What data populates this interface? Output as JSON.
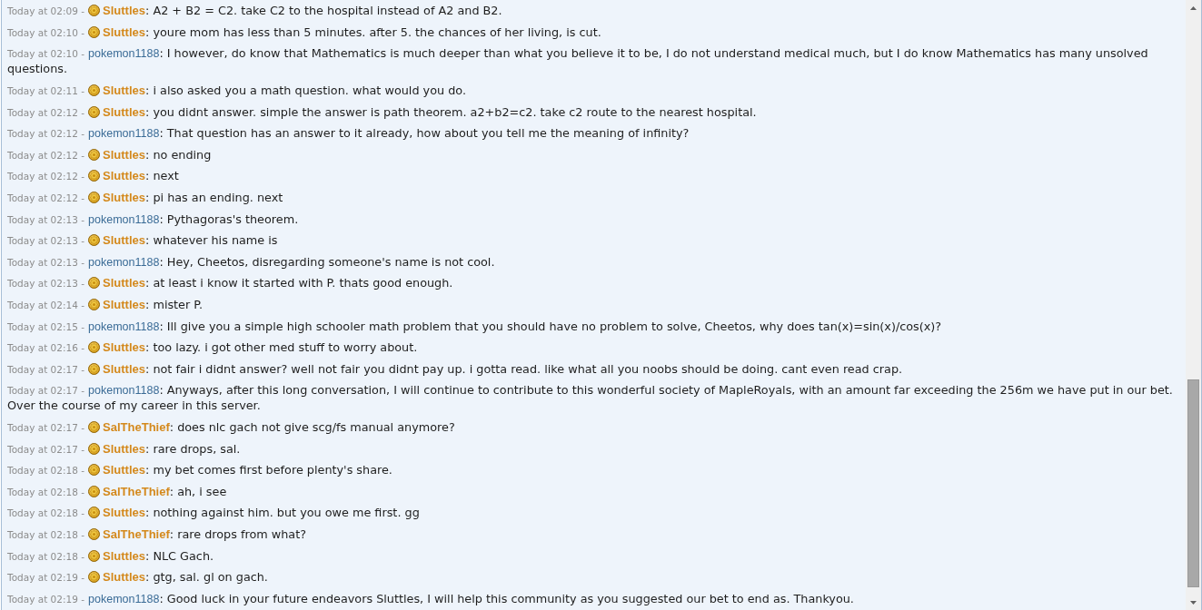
{
  "messages": [
    {
      "time": "Today at 02:09 -",
      "kind": "badged",
      "user": "Sluttles",
      "text": ": A2 + B2 = C2. take C2 to the hospital instead of A2 and B2."
    },
    {
      "time": "Today at 02:10 -",
      "kind": "badged",
      "user": "Sluttles",
      "text": ": youre mom has less than 5 minutes. after 5. the chances of her living, is cut."
    },
    {
      "time": "Today at 02:10 -",
      "kind": "plain",
      "user": "pokemon1188",
      "text": ": I however, do know that Mathematics is much deeper than what you believe it to be, I do not understand medical much, but I do know Mathematics has many unsolved questions."
    },
    {
      "time": "Today at 02:11 -",
      "kind": "badged",
      "user": "Sluttles",
      "text": ": i also asked you a math question. what would you do."
    },
    {
      "time": "Today at 02:12 -",
      "kind": "badged",
      "user": "Sluttles",
      "text": ": you didnt answer. simple the answer is path theorem. a2+b2=c2. take c2 route to the nearest hospital."
    },
    {
      "time": "Today at 02:12 -",
      "kind": "plain",
      "user": "pokemon1188",
      "text": ": That question has an answer to it already, how about you tell me the meaning of infinity?"
    },
    {
      "time": "Today at 02:12 -",
      "kind": "badged",
      "user": "Sluttles",
      "text": ": no ending"
    },
    {
      "time": "Today at 02:12 -",
      "kind": "badged",
      "user": "Sluttles",
      "text": ": next"
    },
    {
      "time": "Today at 02:12 -",
      "kind": "badged",
      "user": "Sluttles",
      "text": ": pi has an ending. next"
    },
    {
      "time": "Today at 02:13 -",
      "kind": "plain",
      "user": "pokemon1188",
      "text": ": Pythagoras's theorem."
    },
    {
      "time": "Today at 02:13 -",
      "kind": "badged",
      "user": "Sluttles",
      "text": ": whatever his name is"
    },
    {
      "time": "Today at 02:13 -",
      "kind": "plain",
      "user": "pokemon1188",
      "text": ": Hey, Cheetos, disregarding someone's name is not cool."
    },
    {
      "time": "Today at 02:13 -",
      "kind": "badged",
      "user": "Sluttles",
      "text": ": at least i know it started with P. thats good enough."
    },
    {
      "time": "Today at 02:14 -",
      "kind": "badged",
      "user": "Sluttles",
      "text": ": mister P."
    },
    {
      "time": "Today at 02:15 -",
      "kind": "plain",
      "user": "pokemon1188",
      "text": ": Ill give you a simple high schooler math problem that you should have no problem to solve, Cheetos, why does tan(x)=sin(x)/cos(x)?"
    },
    {
      "time": "Today at 02:16 -",
      "kind": "badged",
      "user": "Sluttles",
      "text": ": too lazy. i got other med stuff to worry about."
    },
    {
      "time": "Today at 02:17 -",
      "kind": "badged",
      "user": "Sluttles",
      "text": ": not fair i didnt answer? well not fair you didnt pay up. i gotta read. like what all you noobs should be doing. cant even read crap."
    },
    {
      "time": "Today at 02:17 -",
      "kind": "plain",
      "user": "pokemon1188",
      "text": ": Anyways, after this long conversation, I will continue to contribute to this wonderful society of MapleRoyals, with an amount far exceeding the 256m we have put in our bet. Over the course of my career in this server."
    },
    {
      "time": "Today at 02:17 -",
      "kind": "badged",
      "user": "SalTheThief",
      "text": ": does nlc gach not give scg/fs manual anymore?"
    },
    {
      "time": "Today at 02:17 -",
      "kind": "badged",
      "user": "Sluttles",
      "text": ": rare drops, sal."
    },
    {
      "time": "Today at 02:18 -",
      "kind": "badged",
      "user": "Sluttles",
      "text": ": my bet comes first before plenty's share."
    },
    {
      "time": "Today at 02:18 -",
      "kind": "badged",
      "user": "SalTheThief",
      "text": ": ah, i see"
    },
    {
      "time": "Today at 02:18 -",
      "kind": "badged",
      "user": "Sluttles",
      "text": ": nothing against him. but you owe me first. gg"
    },
    {
      "time": "Today at 02:18 -",
      "kind": "badged",
      "user": "SalTheThief",
      "text": ": rare drops from what?"
    },
    {
      "time": "Today at 02:18 -",
      "kind": "badged",
      "user": "Sluttles",
      "text": ": NLC Gach."
    },
    {
      "time": "Today at 02:19 -",
      "kind": "badged",
      "user": "Sluttles",
      "text": ": gtg, sal. gl on gach."
    },
    {
      "time": "Today at 02:19 -",
      "kind": "plain",
      "user": "pokemon1188",
      "text": ": Good luck in your future endeavors Sluttles, I will help this community as you suggested our bet to end as. Thankyou."
    }
  ]
}
